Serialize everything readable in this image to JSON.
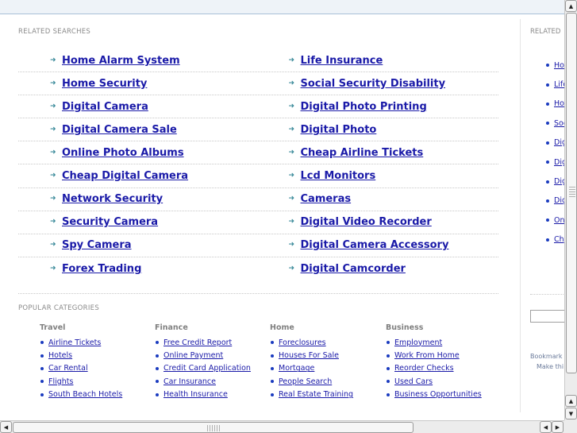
{
  "related_searches": {
    "title": "RELATED SEARCHES",
    "rows": [
      [
        "Home Alarm System",
        "Life Insurance"
      ],
      [
        "Home Security",
        "Social Security Disability"
      ],
      [
        "Digital Camera",
        "Digital Photo Printing"
      ],
      [
        "Digital Camera Sale",
        "Digital Photo"
      ],
      [
        "Online Photo Albums",
        "Cheap Airline Tickets"
      ],
      [
        "Cheap Digital Camera",
        "Lcd Monitors"
      ],
      [
        "Network Security",
        "Cameras"
      ],
      [
        "Security Camera",
        "Digital Video Recorder"
      ],
      [
        "Spy Camera",
        "Digital Camera Accessory"
      ],
      [
        "Forex Trading",
        "Digital Camcorder"
      ]
    ]
  },
  "popular_categories": {
    "title": "POPULAR CATEGORIES",
    "columns": [
      {
        "heading": "Travel",
        "items": [
          "Airline Tickets",
          "Hotels",
          "Car Rental",
          "Flights",
          "South Beach Hotels"
        ]
      },
      {
        "heading": "Finance",
        "items": [
          "Free Credit Report",
          "Online Payment",
          "Credit Card Application",
          "Car Insurance",
          "Health Insurance"
        ]
      },
      {
        "heading": "Home",
        "items": [
          "Foreclosures",
          "Houses For Sale",
          "Mortgage",
          "People Search",
          "Real Estate Training"
        ]
      },
      {
        "heading": "Business",
        "items": [
          "Employment",
          "Work From Home",
          "Reorder Checks",
          "Used Cars",
          "Business Opportunities"
        ]
      }
    ]
  },
  "right_panel": {
    "title": "RELATED",
    "items": [
      "Ho",
      "Life",
      "Ho",
      "Soc",
      "Dig",
      "Dig",
      "Dig",
      "Dig",
      "Onl",
      "Ch"
    ],
    "bookmark_text": "Bookmark",
    "make_text": "Make thi"
  },
  "icons": {
    "arrow": "arrow-right-icon",
    "bullet": "bullet-icon"
  }
}
